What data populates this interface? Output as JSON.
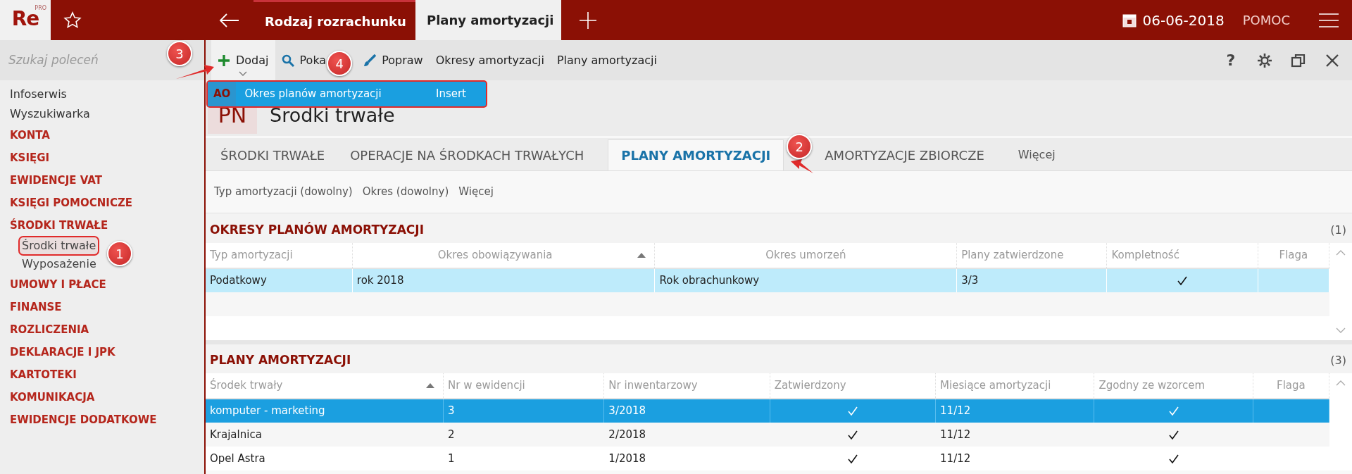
{
  "app": {
    "logo": "Re",
    "logo_badge": "PRO"
  },
  "top_tabs": [
    {
      "label": "Rodzaj rozrachunku",
      "selected": false
    },
    {
      "label": "Plany amortyzacji",
      "selected": true
    }
  ],
  "date": "06-06-2018",
  "help_link": "POMOC",
  "search": {
    "placeholder": "Szukaj poleceń"
  },
  "toolbar": [
    {
      "label": "Dodaj",
      "kind": "plus",
      "dropdown": true
    },
    {
      "label": "Poka",
      "kind": "search",
      "dropdown": false
    },
    {
      "label": "Popraw",
      "kind": "brush",
      "dropdown": false
    },
    {
      "label": "Okresy amortyzacji",
      "kind": "text",
      "dropdown": false
    },
    {
      "label": "Plany amortyzacji",
      "kind": "text",
      "dropdown": false
    }
  ],
  "window_buttons": [
    {
      "kind": "help",
      "label": "?"
    },
    {
      "kind": "settings"
    },
    {
      "kind": "restore"
    },
    {
      "kind": "close"
    }
  ],
  "dropdown_menu": [
    {
      "badge": "AO",
      "label": "Okres planów amortyzacji",
      "shortcut": "Insert",
      "highlighted": true
    }
  ],
  "sidebar": {
    "items": [
      {
        "label": "Infoserwis",
        "kind": "link"
      },
      {
        "label": "Wyszukiwarka",
        "kind": "link"
      },
      {
        "label": "KONTA",
        "kind": "section"
      },
      {
        "label": "KSIĘGI",
        "kind": "section"
      },
      {
        "label": "EWIDENCJE VAT",
        "kind": "section"
      },
      {
        "label": "KSIĘGI POMOCNICZE",
        "kind": "section"
      },
      {
        "label": "ŚRODKI TRWAŁE",
        "kind": "section",
        "children": [
          {
            "label": "Środki trwałe",
            "selected": true,
            "highlighted": true
          },
          {
            "label": "Wyposażenie",
            "selected": false,
            "highlighted": false
          }
        ]
      },
      {
        "label": "UMOWY I PŁACE",
        "kind": "section"
      },
      {
        "label": "FINANSE",
        "kind": "section"
      },
      {
        "label": "ROZLICZENIA",
        "kind": "section"
      },
      {
        "label": "DEKLARACJE I JPK",
        "kind": "section"
      },
      {
        "label": "KARTOTEKI",
        "kind": "section"
      },
      {
        "label": "KOMUNIKACJA",
        "kind": "section"
      },
      {
        "label": "EWIDENCJE DODATKOWE",
        "kind": "section"
      }
    ]
  },
  "page": {
    "badge": "PN",
    "title": "Środki trwałe"
  },
  "tabs": [
    {
      "label": "ŚRODKI TRWAŁE",
      "selected": false,
      "kind": "tab"
    },
    {
      "label": "OPERACJE NA ŚRODKACH TRWAŁYCH",
      "selected": false,
      "kind": "tab"
    },
    {
      "label": "PLANY AMORTYZACJI",
      "selected": true,
      "kind": "tab"
    },
    {
      "label": "AMORTYZACJE ZBIORCZE",
      "selected": false,
      "kind": "tab"
    },
    {
      "label": "Więcej",
      "selected": false,
      "kind": "more"
    }
  ],
  "filters": [
    "Typ amortyzacji (dowolny)",
    "Okres (dowolny)",
    "Więcej"
  ],
  "sections": [
    {
      "title": "OKRESY PLANÓW AMORTYZACJI",
      "count": "(1)",
      "active": false,
      "columns": [
        {
          "label": "Typ amortyzacji",
          "sorted": false,
          "kind": "text"
        },
        {
          "label": "Okres obowiązywania",
          "sorted": true,
          "kind": "text"
        },
        {
          "label": "Okres umorzeń",
          "sorted": false,
          "kind": "text"
        },
        {
          "label": "Plany zatwierdzone",
          "sorted": false,
          "kind": "text"
        },
        {
          "label": "Kompletność",
          "sorted": false,
          "kind": "check"
        },
        {
          "label": "Flaga",
          "sorted": false,
          "kind": "text"
        }
      ],
      "rows": [
        {
          "selected": true,
          "cells": [
            "Podatkowy",
            "rok 2018",
            "Rok obrachunkowy",
            "3/3",
            true
          ]
        }
      ]
    },
    {
      "title": "PLANY AMORTYZACJI",
      "count": "(3)",
      "active": true,
      "columns": [
        {
          "label": "Środek trwały",
          "sorted": true,
          "kind": "text"
        },
        {
          "label": "Nr w ewidencji",
          "sorted": false,
          "kind": "text"
        },
        {
          "label": "Nr inwentarzowy",
          "sorted": false,
          "kind": "text"
        },
        {
          "label": "Zatwierdzony",
          "sorted": false,
          "kind": "check"
        },
        {
          "label": "Miesiące amortyzacji",
          "sorted": false,
          "kind": "text"
        },
        {
          "label": "Zgodny ze wzorcem",
          "sorted": false,
          "kind": "check"
        },
        {
          "label": "Flaga",
          "sorted": false,
          "kind": "text"
        }
      ],
      "rows": [
        {
          "selected": true,
          "cells": [
            "komputer - marketing",
            "3",
            "3/2018",
            true,
            "11/12",
            true
          ]
        },
        {
          "selected": false,
          "cells": [
            "Krajalnica",
            "2",
            "2/2018",
            true,
            "11/12",
            true
          ]
        },
        {
          "selected": false,
          "cells": [
            "Opel Astra",
            "1",
            "1/2018",
            true,
            "11/12",
            true
          ]
        }
      ]
    }
  ],
  "annotations": [
    {
      "number": "1"
    },
    {
      "number": "2"
    },
    {
      "number": "3"
    },
    {
      "number": "4"
    }
  ]
}
